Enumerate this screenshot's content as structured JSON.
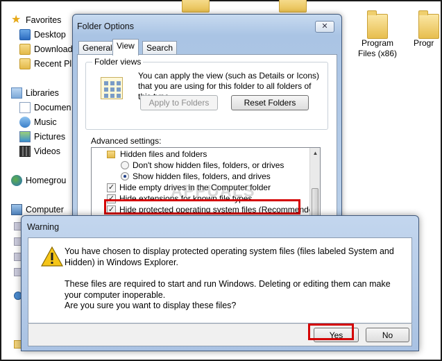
{
  "nav": {
    "favorites": "Favorites",
    "desktop": "Desktop",
    "downloads": "Download",
    "recent": "Recent Pl",
    "libraries": "Libraries",
    "documents": "Documen",
    "music": "Music",
    "pictures": "Pictures",
    "videos": "Videos",
    "homegroup": "Homegrou",
    "computer": "Computer"
  },
  "desktop_items": [
    {
      "label_line1": "Program",
      "label_line2": "Files (x86)"
    },
    {
      "label_line1": "Progr",
      "label_line2": ""
    }
  ],
  "folder_options": {
    "title": "Folder Options",
    "close_label": "✕",
    "tabs": [
      "General",
      "View",
      "Search"
    ],
    "active_tab": "View",
    "folder_views_label": "Folder views",
    "folder_views_text": "You can apply the view (such as Details or Icons) that you are using for this folder to all folders of this type.",
    "apply_button": "Apply to Folders",
    "reset_button": "Reset Folders",
    "advanced_label": "Advanced settings:",
    "advanced_items": [
      {
        "type": "folder",
        "label": "Hidden files and folders"
      },
      {
        "type": "radio",
        "checked": false,
        "label": "Don't show hidden files, folders, or drives"
      },
      {
        "type": "radio",
        "checked": true,
        "label": "Show hidden files, folders, and drives"
      },
      {
        "type": "checkbox",
        "checked": true,
        "label": "Hide empty drives in the Computer folder"
      },
      {
        "type": "checkbox",
        "checked": true,
        "label": "Hide extensions for known file types"
      },
      {
        "type": "checkbox",
        "checked": true,
        "label": "Hide protected operating system files (Recommended)"
      }
    ]
  },
  "warning": {
    "title": "Warning",
    "line1": "You have chosen to display protected operating system files (files labeled System and Hidden) in Windows Explorer.",
    "line2": "These files are required to start and run Windows. Deleting or editing them can make your computer inoperable.",
    "line3": "Are you sure you want to display these files?",
    "yes_button": "Yes",
    "no_button": "No"
  },
  "watermark": "APPUALS",
  "colors": {
    "highlight_red": "#d40000",
    "title_bar": "#b9cfe9"
  }
}
